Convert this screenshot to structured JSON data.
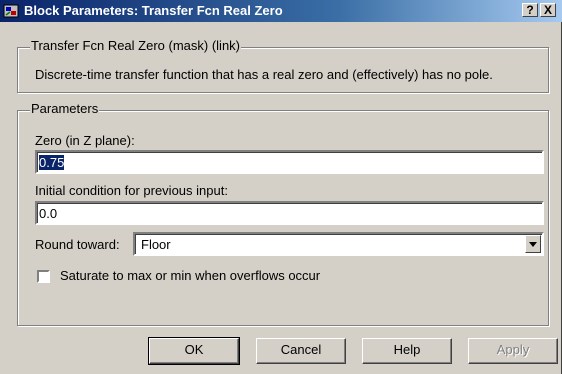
{
  "window": {
    "title": "Block Parameters: Transfer Fcn Real Zero",
    "help_glyph": "?",
    "close_glyph": "X"
  },
  "description_group": {
    "legend": "Transfer Fcn Real Zero (mask) (link)",
    "text": "Discrete-time transfer function that has a real zero and (effectively) has no pole."
  },
  "parameters_group": {
    "legend": "Parameters",
    "zero": {
      "label": "Zero (in Z plane):",
      "value": "0.75"
    },
    "initial_condition": {
      "label": "Initial condition for previous input:",
      "value": "0.0"
    },
    "round_toward": {
      "label": "Round toward:",
      "selected": "Floor"
    },
    "saturate": {
      "label": "Saturate to max or min when overflows occur",
      "checked": false
    }
  },
  "buttons": {
    "ok": "OK",
    "cancel": "Cancel",
    "help": "Help",
    "apply": "Apply"
  },
  "colors": {
    "title_bar": "#0a246a",
    "face": "#d4d0c8",
    "selection": "#0a246a"
  },
  "icons": {
    "app": "simulink-block-icon",
    "help": "question-mark-icon",
    "close": "close-icon",
    "dropdown": "chevron-down-icon"
  }
}
